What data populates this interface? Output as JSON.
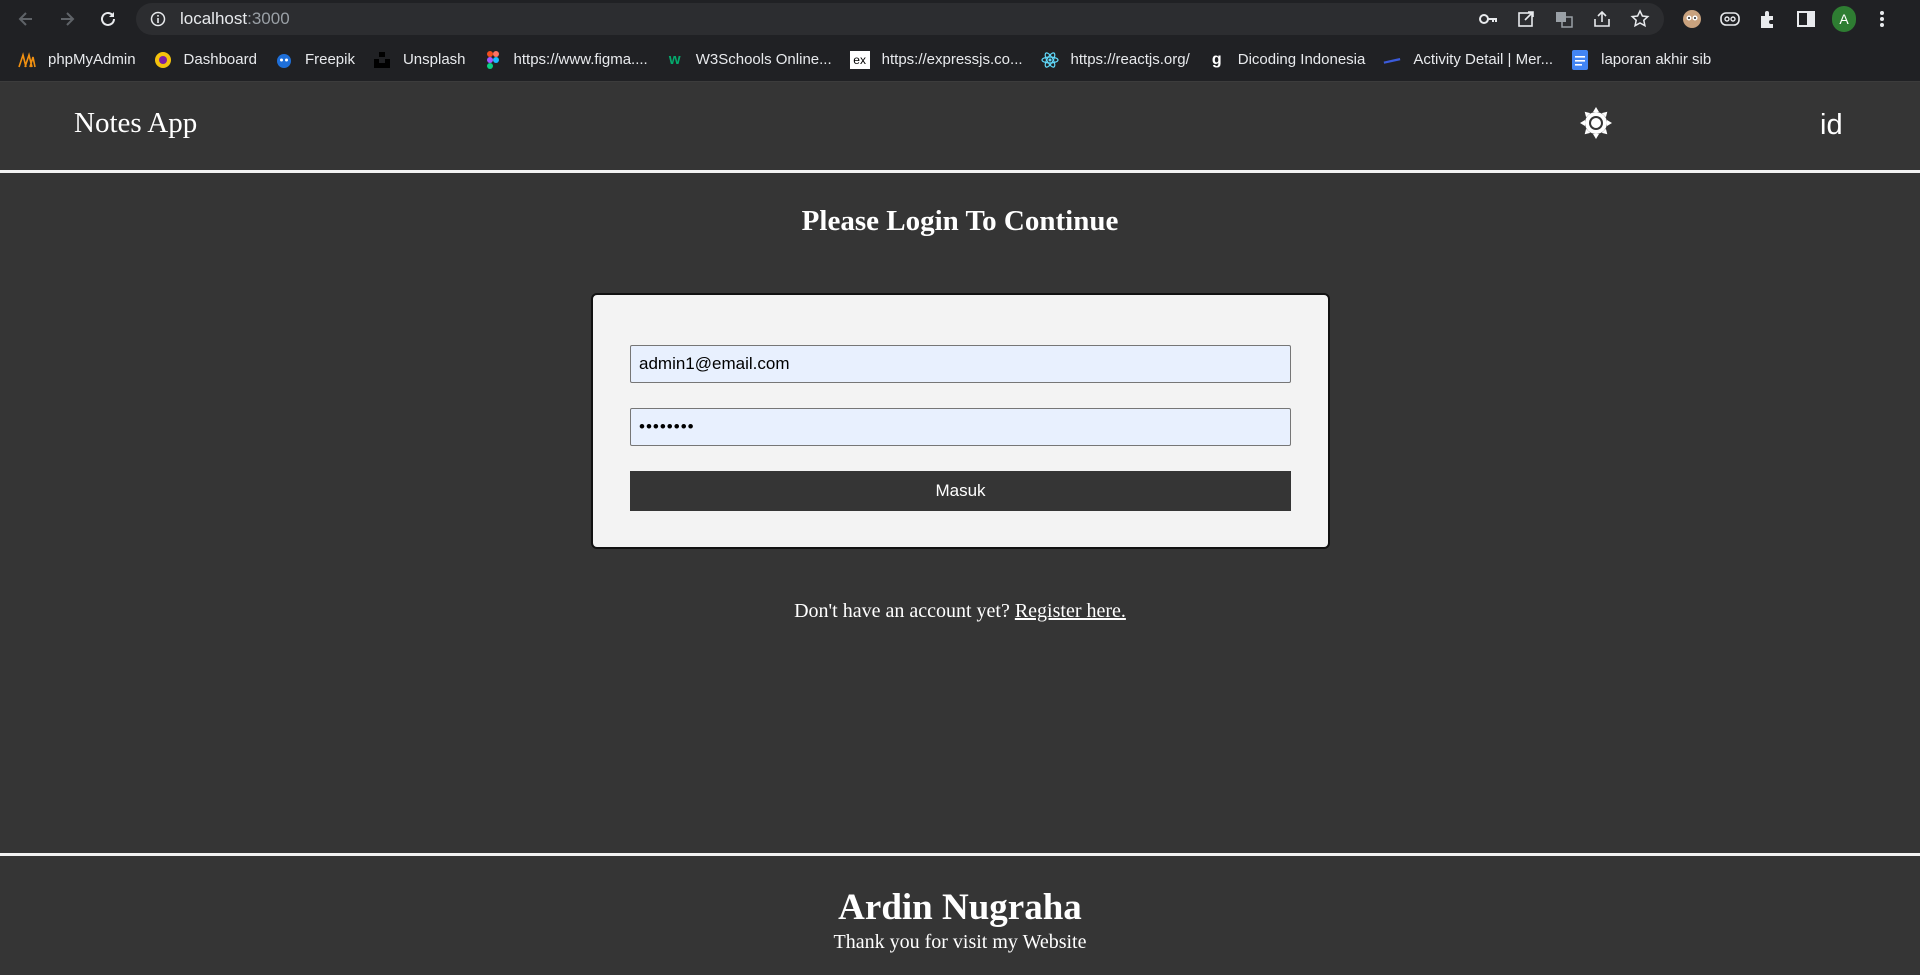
{
  "browser": {
    "url_host": "localhost",
    "url_port": ":3000",
    "profile_initial": "A",
    "bookmarks": [
      {
        "label": "phpMyAdmin",
        "icon": "phpmyadmin-icon"
      },
      {
        "label": "Dashboard",
        "icon": "dashboard-icon"
      },
      {
        "label": "Freepik",
        "icon": "freepik-icon"
      },
      {
        "label": "Unsplash",
        "icon": "unsplash-icon"
      },
      {
        "label": "https://www.figma....",
        "icon": "figma-icon"
      },
      {
        "label": "W3Schools Online...",
        "icon": "w3schools-icon"
      },
      {
        "label": "https://expressjs.co...",
        "icon": "express-icon"
      },
      {
        "label": "https://reactjs.org/",
        "icon": "react-icon"
      },
      {
        "label": "Dicoding Indonesia",
        "icon": "dicoding-icon"
      },
      {
        "label": "Activity Detail | Mer...",
        "icon": "activity-icon"
      },
      {
        "label": "laporan akhir sib",
        "icon": "docs-icon"
      }
    ]
  },
  "app": {
    "brand": "Notes App",
    "lang_toggle": "id",
    "theme_icon": "sun-icon"
  },
  "login": {
    "title": "Please Login To Continue",
    "email_value": "admin1@email.com",
    "password_value": "••••••••",
    "submit_label": "Masuk",
    "register_prompt": "Don't have an account yet?",
    "register_link": "Register here."
  },
  "footer": {
    "name": "Ardin Nugraha",
    "note": "Thank you for visit my Website"
  }
}
